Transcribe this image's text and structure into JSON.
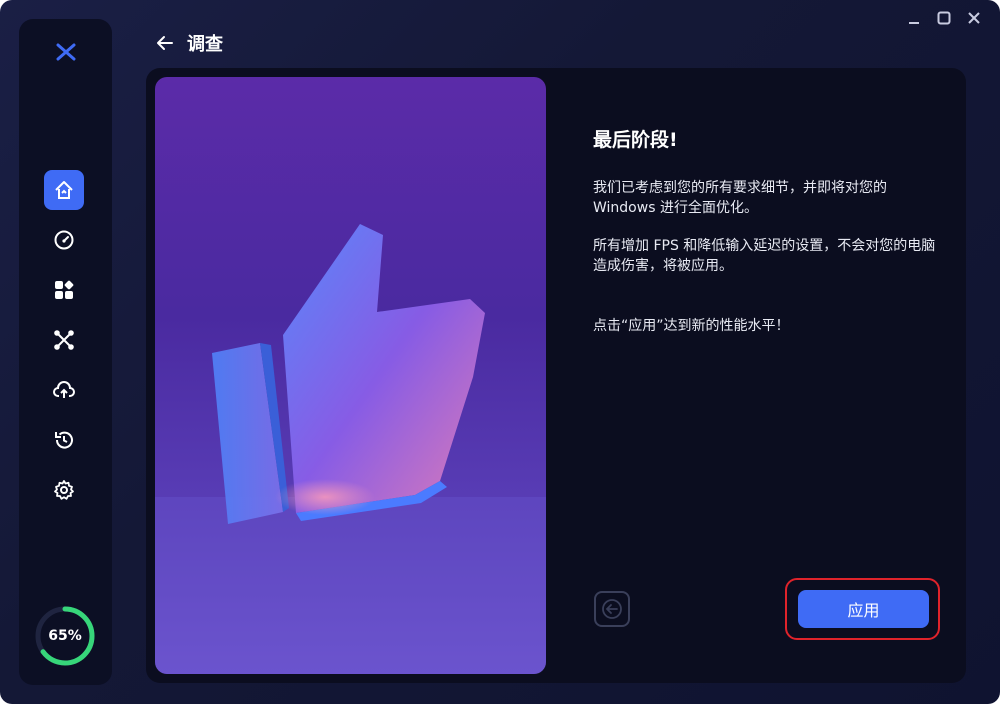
{
  "header": {
    "title": "调查"
  },
  "sidebar": {
    "items": [
      {
        "icon": "home-icon",
        "active": true
      },
      {
        "icon": "speedometer-icon",
        "active": false
      },
      {
        "icon": "apps-grid-icon",
        "active": false
      },
      {
        "icon": "network-nodes-icon",
        "active": false
      },
      {
        "icon": "cloud-upload-icon",
        "active": false
      },
      {
        "icon": "restore-icon",
        "active": false
      },
      {
        "icon": "gear-icon",
        "active": false
      }
    ],
    "progress": {
      "label": "65%",
      "value": 0.65
    }
  },
  "content": {
    "title": "最后阶段!",
    "paragraph1": "我们已考虑到您的所有要求细节，并即将对您的 Windows 进行全面优化。",
    "paragraph2": "所有增加 FPS 和降低输入延迟的设置，不会对您的电脑造成伤害，将被应用。",
    "cta": "点击“应用”达到新的性能水平！"
  },
  "actions": {
    "apply_label": "应用"
  },
  "colors": {
    "accent": "#3f6bf5",
    "highlight": "#e0232b",
    "progress": "#37d67a"
  }
}
